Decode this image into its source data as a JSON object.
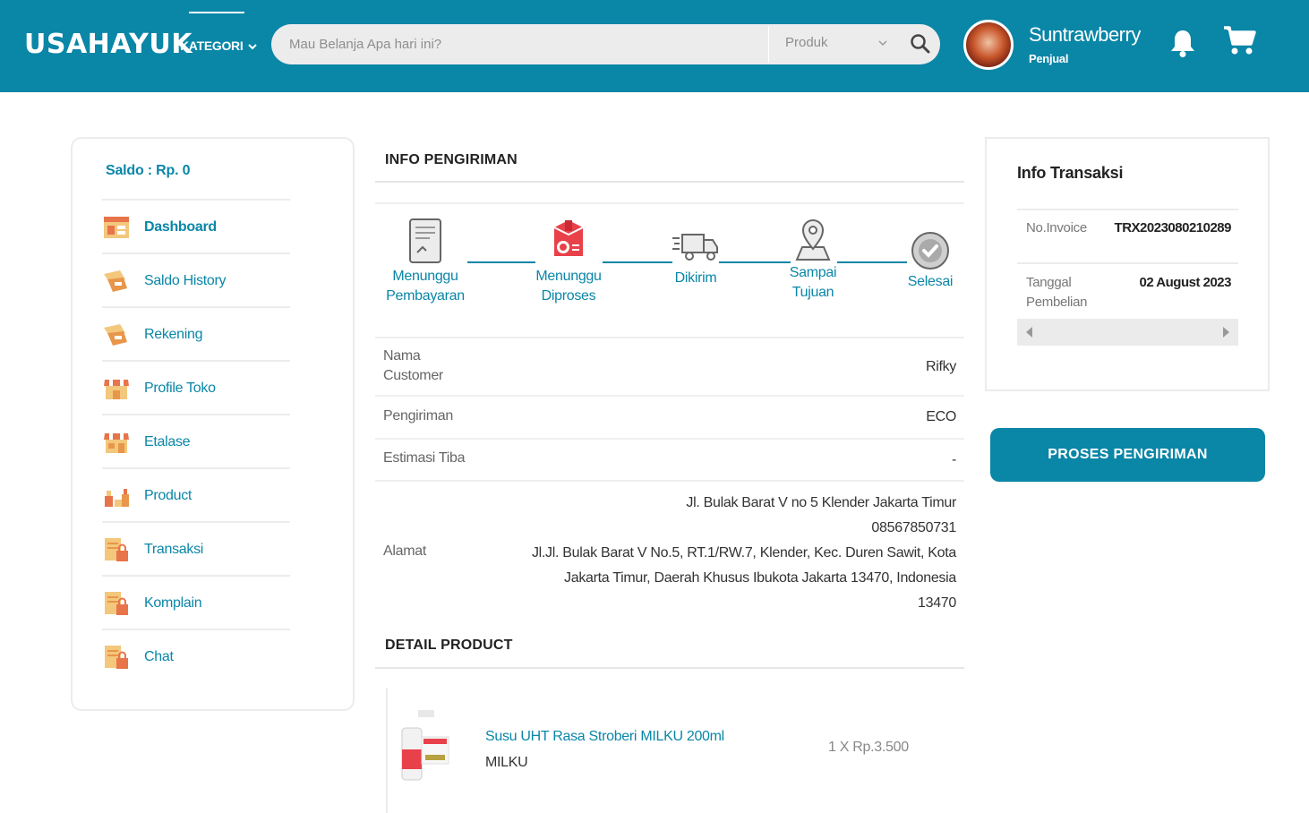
{
  "header": {
    "logo": "USAHAYUK",
    "kategori_label": "KATEGORI",
    "search_placeholder": "Mau Belanja Apa hari ini?",
    "search_scope": "Produk",
    "user_name": "Suntrawberry",
    "user_role": "Penjual",
    "brand_color": "#0a86a7"
  },
  "sidebar": {
    "saldo": "Saldo : Rp. 0",
    "items": [
      {
        "label": "Dashboard",
        "icon": "dashboard-icon",
        "active": true
      },
      {
        "label": "Saldo History",
        "icon": "saldo-history-icon"
      },
      {
        "label": "Rekening",
        "icon": "rekening-icon"
      },
      {
        "label": "Profile Toko",
        "icon": "store-icon"
      },
      {
        "label": "Etalase",
        "icon": "etalase-icon"
      },
      {
        "label": "Product",
        "icon": "product-icon"
      },
      {
        "label": "Transaksi",
        "icon": "transaksi-icon"
      },
      {
        "label": "Komplain",
        "icon": "komplain-icon"
      },
      {
        "label": "Chat",
        "icon": "chat-icon"
      }
    ]
  },
  "shipping": {
    "title": "INFO PENGIRIMAN",
    "steps": [
      {
        "line1": "Menunggu",
        "line2": "Pembayaran",
        "icon": "document-icon",
        "state": "done"
      },
      {
        "line1": "Menunggu",
        "line2": "Diproses",
        "icon": "package-icon",
        "state": "current"
      },
      {
        "line1": "Dikirim",
        "line2": "",
        "icon": "truck-icon",
        "state": "pending"
      },
      {
        "line1": "Sampai",
        "line2": "Tujuan",
        "icon": "map-pin-icon",
        "state": "pending"
      },
      {
        "line1": "Selesai",
        "line2": "",
        "icon": "check-circle-icon",
        "state": "pending"
      }
    ],
    "customer_label_1": "Nama",
    "customer_label_2": "Customer",
    "customer_value": "Rifky",
    "pengiriman_label": "Pengiriman",
    "pengiriman_value": "ECO",
    "estimasi_label": "Estimasi Tiba",
    "estimasi_value": "-",
    "alamat_label": "Alamat",
    "alamat_lines": [
      "Jl. Bulak Barat V no 5 Klender Jakarta Timur",
      "08567850731",
      "Jl.Jl. Bulak Barat V No.5, RT.1/RW.7, Klender, Kec. Duren Sawit, Kota",
      "Jakarta Timur, Daerah Khusus Ibukota Jakarta 13470, Indonesia",
      "13470"
    ]
  },
  "product": {
    "title": "DETAIL PRODUCT",
    "name": "Susu UHT Rasa Stroberi MILKU 200ml",
    "brand": "MILKU",
    "price": "1 X Rp.3.500"
  },
  "transaction": {
    "title": "Info Transaksi",
    "invoice_label": "No.Invoice",
    "invoice_value": "TRX2023080210289",
    "tanggal_label_1": "Tanggal",
    "tanggal_label_2": "Pembelian",
    "tanggal_value": "02 August 2023",
    "proses_button": "PROSES PENGIRIMAN"
  }
}
